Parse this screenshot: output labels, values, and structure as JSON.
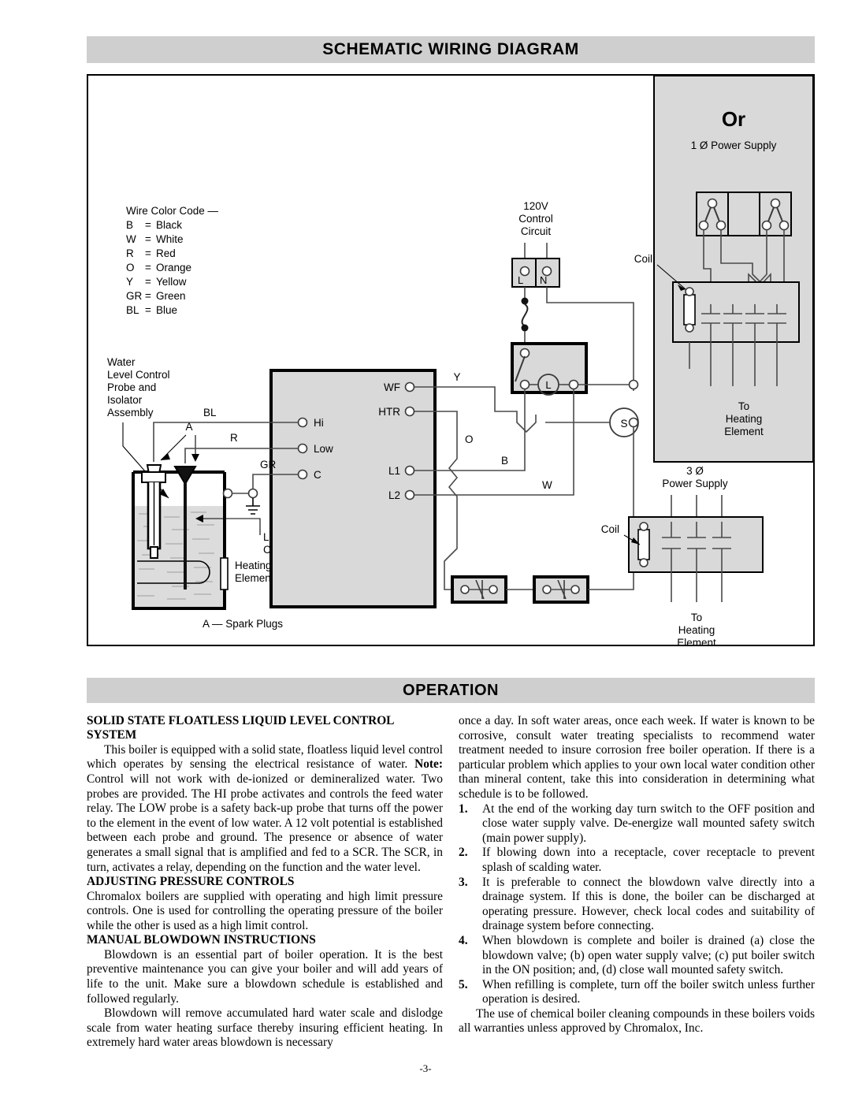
{
  "headers": {
    "schematic": "SCHEMATIC WIRING DIAGRAM",
    "operation": "OPERATION"
  },
  "diagram": {
    "wire_color_code": {
      "title": "Wire Color Code —",
      "entries": [
        {
          "code": "B",
          "eq": "=",
          "color": "Black"
        },
        {
          "code": "W",
          "eq": "=",
          "color": "White"
        },
        {
          "code": "R",
          "eq": "=",
          "color": "Red"
        },
        {
          "code": "O",
          "eq": "=",
          "color": "Orange"
        },
        {
          "code": "Y",
          "eq": "=",
          "color": "Yellow"
        },
        {
          "code": "GR",
          "eq": "=",
          "color": "Green"
        },
        {
          "code": "BL",
          "eq": "=",
          "color": "Blue"
        }
      ]
    },
    "labels": {
      "water_level_assembly": [
        "Water",
        "Level Control",
        "Probe and",
        "Isolator",
        "Assembly"
      ],
      "low_water_probe": [
        "Low Water",
        "Cut-Off Probe"
      ],
      "heating_element_tank": [
        "Heating",
        "Element"
      ],
      "spark_plugs": "A — Spark Plugs",
      "spark_plug_marker": "A",
      "control_circuit_120v": [
        "120V",
        "Control",
        "Circuit"
      ],
      "terminal_L": "L",
      "terminal_N": "N",
      "lamp": "L",
      "solenoid": "S",
      "coil_single_phase": "Coil",
      "coil_three_phase": "Coil",
      "or_title": "Or",
      "one_phase_supply": "1 Ø Power Supply",
      "three_phase_supply": [
        "3 Ø",
        "Power Supply"
      ],
      "to_heating_element_1ph": [
        "To",
        "Heating",
        "Element"
      ],
      "to_heating_element_3ph": [
        "To",
        "Heating",
        "Element"
      ]
    },
    "control_terminals": [
      "Hi",
      "Low",
      "C",
      "WF",
      "HTR",
      "L1",
      "L2"
    ],
    "probe_wire_labels": [
      "BL",
      "R",
      "GR"
    ],
    "circuit_wire_labels": [
      "Y",
      "O",
      "B",
      "W"
    ]
  },
  "operation": {
    "left_column": {
      "heading1": "SOLID STATE FLOATLESS LIQUID LEVEL CONTROL SYSTEM",
      "para1_a": "This boiler is equipped with a solid state, floatless liquid level control which operates by sensing the electrical resistance of water. ",
      "para1_note": "Note:",
      "para1_b": " Control will not work with de-ionized or demineralized water. Two probes are provided. The HI probe activates and controls the feed water relay. The LOW probe is a safety back-up probe that turns off the power to the element in the event of low water. A 12 volt potential is established between each probe and ground. The presence or absence of water generates a small signal that is amplified and fed to a SCR. The SCR, in turn, activates a relay, depending on the function and the water level.",
      "heading2": "ADJUSTING PRESSURE CONTROLS",
      "para2": "Chromalox boilers are supplied with operating and high limit pressure controls. One is used for controlling the operating pressure of the boiler while the other is used as a high limit control.",
      "heading3": "MANUAL BLOWDOWN INSTRUCTIONS",
      "para3": "Blowdown is an essential part of boiler operation. It is the best preventive maintenance you can give your boiler and will add years of life to the unit. Make sure a blowdown schedule is established and followed regularly.",
      "para4": "Blowdown will remove accumulated hard water scale and dislodge scale from water heating surface thereby insuring efficient heating. In extremely hard water areas blowdown is necessary"
    },
    "right_column": {
      "para_continued": "once a day. In soft water areas, once each week. If water is known to be corrosive, consult water treating specialists to recommend water treatment needed to insure corrosion free boiler operation. If there is a particular problem which applies to your own local water condition other than mineral content, take this into consideration in determining what schedule is to be followed.",
      "steps": [
        {
          "num": "1.",
          "text": "At the end of the working day turn switch to the OFF position and close water supply valve. De-energize wall mounted safety switch (main power supply)."
        },
        {
          "num": "2.",
          "text": "If blowing down into a receptacle, cover receptacle to prevent splash of scalding water."
        },
        {
          "num": "3.",
          "text": "It is preferable to connect the blowdown valve directly into a drainage system. If this is done, the boiler can be discharged at operating pressure. However, check local codes and suitability of drainage system before connecting."
        },
        {
          "num": "4.",
          "text": "When blowdown is complete and boiler is drained (a) close the blowdown valve; (b) open water supply valve; (c) put boiler switch in the ON position; and, (d) close wall mounted safety switch."
        },
        {
          "num": "5.",
          "text": "When refilling is complete, turn off the boiler switch unless further operation is desired."
        }
      ],
      "closing_para": "The use of chemical boiler cleaning compounds in these boilers voids all warranties unless approved by Chromalox, Inc."
    }
  },
  "footer": {
    "page_number": "-3-"
  },
  "colors": {
    "header_bar": "#cfcfcf",
    "panel_fill": "#d9d9d9",
    "wire": "#4a4a4a",
    "text": "#000000"
  }
}
